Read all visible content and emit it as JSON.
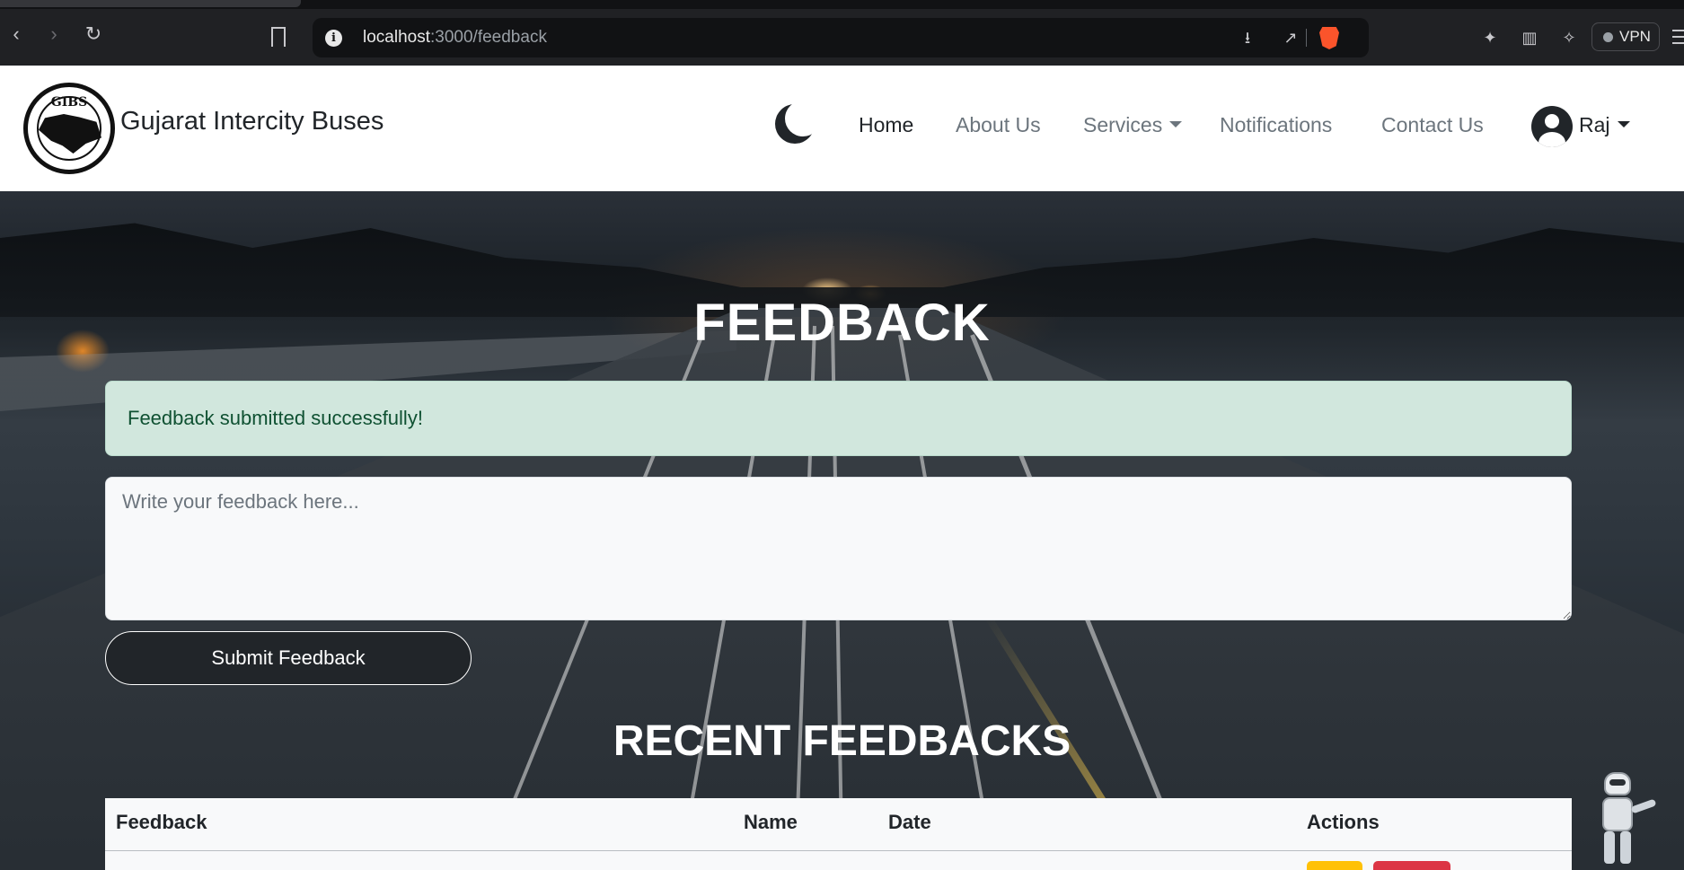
{
  "browser": {
    "url_host": "localhost",
    "url_path": ":3000/feedback",
    "vpn_label": "VPN",
    "icons": [
      "back-icon",
      "forward-icon",
      "reload-icon",
      "bookmark-icon",
      "site-info-icon",
      "install-app-icon",
      "share-icon",
      "brave-shield-icon",
      "extensions-icon",
      "sidebar-icon",
      "leo-ai-icon",
      "menu-icon"
    ]
  },
  "site": {
    "logo_text": "GIBS",
    "brand_name": "Gujarat Intercity Buses",
    "theme_icon": "moon-icon",
    "nav": {
      "home": "Home",
      "about": "About Us",
      "services": "Services",
      "notifications": "Notifications",
      "contact": "Contact Us"
    },
    "user": {
      "name": "Raj",
      "avatar_icon": "user-avatar-icon"
    }
  },
  "page": {
    "title": "FEEDBACK",
    "alert_message": "Feedback submitted successfully!",
    "feedback_placeholder": "Write your feedback here...",
    "feedback_value": "",
    "submit_label": "Submit Feedback",
    "recent_title": "RECENT FEEDBACKS",
    "table": {
      "columns": [
        "Feedback",
        "Name",
        "Date",
        "Actions"
      ]
    }
  },
  "colors": {
    "alert_bg": "#d1e7dd",
    "alert_text": "#0f5132",
    "button_dark": "#212529",
    "edit_button": "#ffc107",
    "delete_button": "#dc3545"
  }
}
